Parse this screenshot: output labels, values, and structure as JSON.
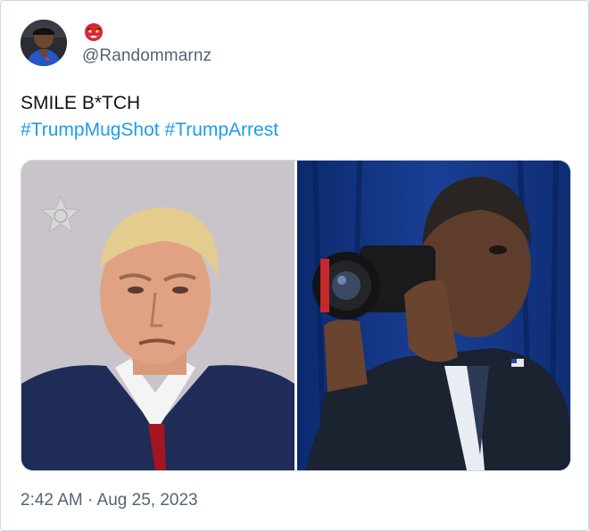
{
  "tweet": {
    "author": {
      "handle": "@Randommarnz",
      "avatar": "avatar-photo",
      "badge_icon": "ogre-mask-emoji-icon"
    },
    "text": "SMILE B*TCH",
    "hashtags": [
      "#TrumpMugShot",
      "#TrumpArrest"
    ],
    "media": [
      {
        "name": "mugshot-photo",
        "icon": "sheriff-seal-icon"
      },
      {
        "name": "camera-photo",
        "icon": "camera-icon"
      }
    ],
    "timestamp": "2:42 AM · Aug 25, 2023"
  },
  "colors": {
    "link": "#1d9bf0",
    "secondary_text": "#536471",
    "border": "#cfd9de"
  }
}
